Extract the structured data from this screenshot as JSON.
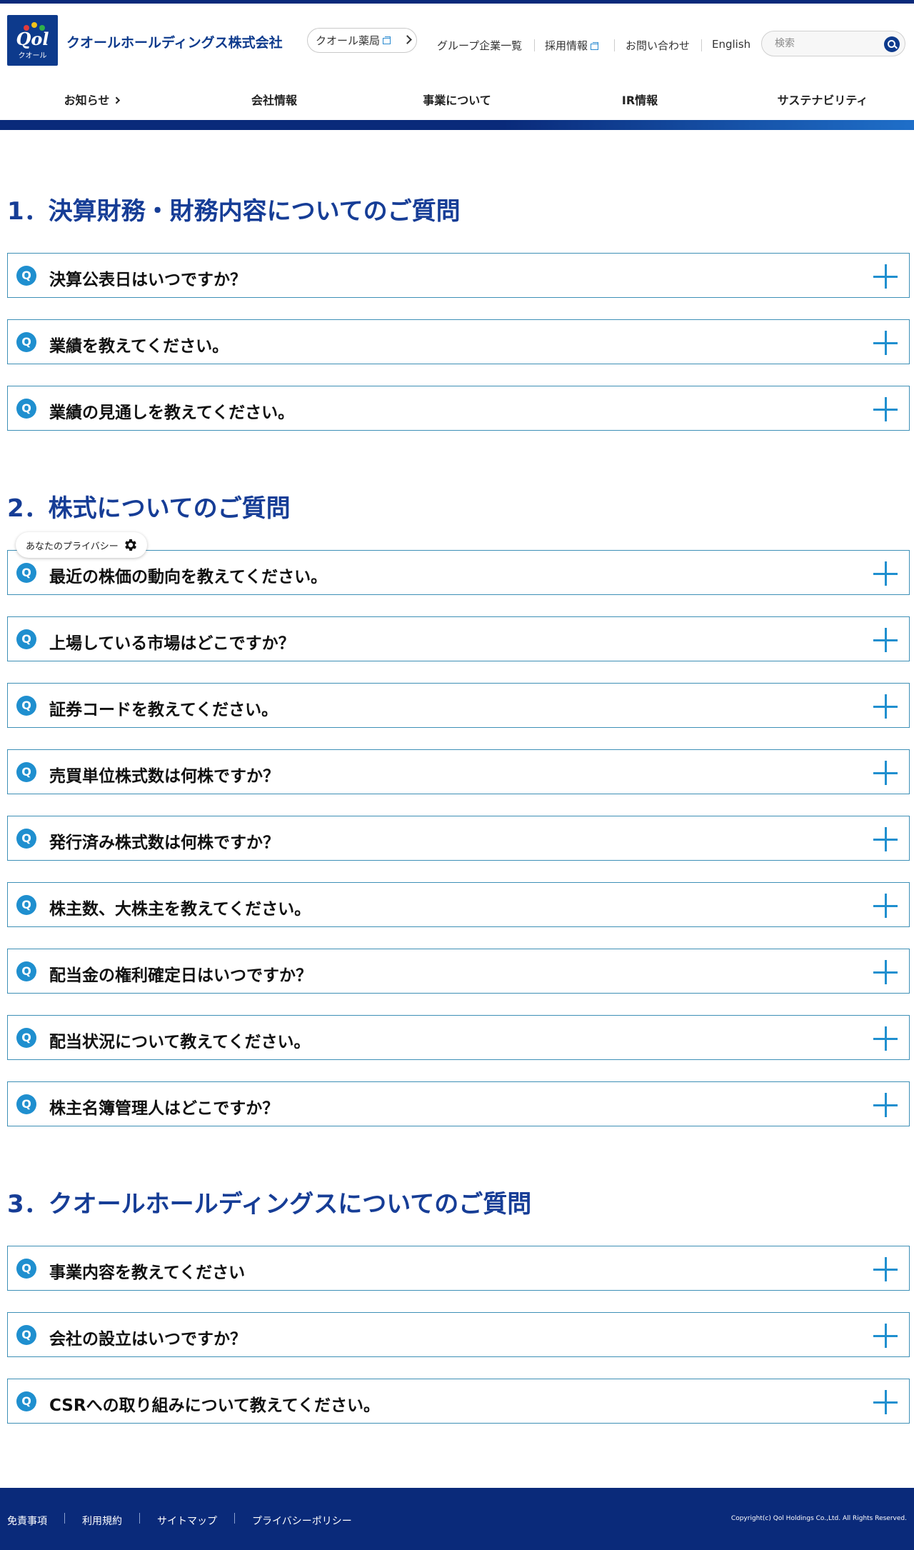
{
  "header": {
    "logo_text": "Qol",
    "logo_sub": "クオール",
    "company_name": "クオールホールディングス株式会社",
    "pharmacy_label": "クオール薬局",
    "util_links": [
      "グループ企業一覧",
      "採用情報",
      "お問い合わせ",
      "English"
    ],
    "search_placeholder": "検索"
  },
  "nav": {
    "items": [
      "お知らせ",
      "会社情報",
      "事業について",
      "IR情報",
      "サステナビリティ"
    ]
  },
  "sections": [
    {
      "title": "1．決算財務・財務内容についてのご質問",
      "questions": [
        "決算公表日はいつですか？",
        "業績を教えてください。",
        "業績の見通しを教えてください。"
      ]
    },
    {
      "title": "2．株式についてのご質問",
      "questions": [
        "最近の株価の動向を教えてください。",
        "上場している市場はどこですか？",
        "証券コードを教えてください。",
        "売買単位株式数は何株ですか？",
        "発行済み株式数は何株ですか？",
        "株主数、大株主を教えてください。",
        "配当金の権利確定日はいつですか？",
        "配当状況について教えてください。",
        "株主名簿管理人はどこですか？"
      ]
    },
    {
      "title": "3．クオールホールディングスについてのご質問",
      "questions": [
        "事業内容を教えてください",
        "会社の設立はいつですか？",
        "CSRへの取り組みについて教えてください。"
      ]
    }
  ],
  "q_badge": "Q",
  "privacy_label": "あなたのプライバシー",
  "footer": {
    "links": [
      "免責事項",
      "利用規約",
      "サイトマップ",
      "プライバシーポリシー"
    ],
    "copyright": "Copyright(c) Qol Holdings Co.,Ltd. All Rights Reserved."
  },
  "colors": {
    "brand_navy": "#0a2a7a",
    "heading_blue": "#163d96",
    "accent_blue": "#1f8fcf"
  }
}
